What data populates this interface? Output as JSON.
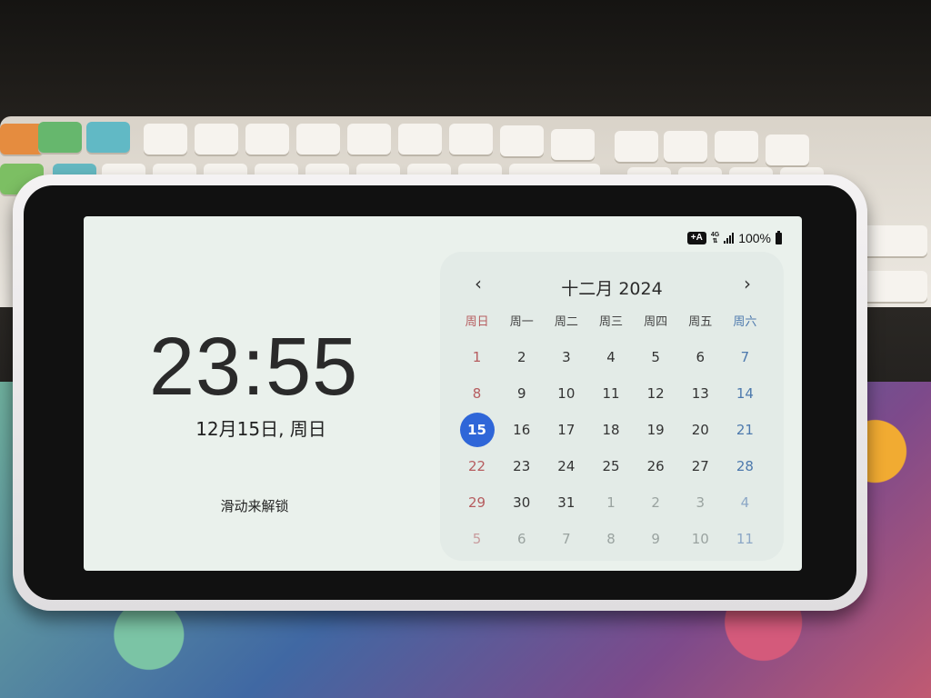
{
  "status_bar": {
    "badge": "+A",
    "network": "4G",
    "battery": "100%"
  },
  "lock_screen": {
    "time": "23:55",
    "date": "12月15日, 周日",
    "unlock_text": "滑动来解锁"
  },
  "calendar": {
    "title": "十二月 2024",
    "prev": "‹",
    "next": "›",
    "weekdays": [
      "周日",
      "周一",
      "周二",
      "周三",
      "周四",
      "周五",
      "周六"
    ],
    "weeks": [
      [
        "1",
        "2",
        "3",
        "4",
        "5",
        "6",
        "7"
      ],
      [
        "8",
        "9",
        "10",
        "11",
        "12",
        "13",
        "14"
      ],
      [
        "15",
        "16",
        "17",
        "18",
        "19",
        "20",
        "21"
      ],
      [
        "22",
        "23",
        "24",
        "25",
        "26",
        "27",
        "28"
      ],
      [
        "29",
        "30",
        "31",
        "1",
        "2",
        "3",
        "4"
      ],
      [
        "5",
        "6",
        "7",
        "8",
        "9",
        "10",
        "11"
      ]
    ],
    "selected": "15"
  },
  "colors": {
    "selected_day": "#2f66d8",
    "sunday": "#b65c5f",
    "saturday": "#4d79ad"
  }
}
